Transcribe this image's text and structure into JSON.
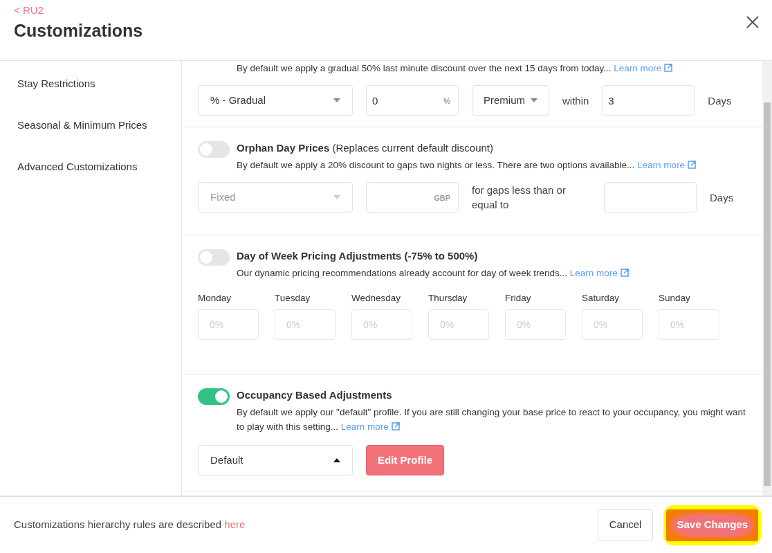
{
  "back_link": "< RU2",
  "title": "Customizations",
  "sidebar": {
    "items": [
      {
        "label": "Stay Restrictions"
      },
      {
        "label": "Seasonal & Minimum Prices"
      },
      {
        "label": "Advanced Customizations"
      }
    ]
  },
  "sections": [
    {
      "description": "By default we apply a gradual 50% last minute discount over the next 15 days from today...",
      "link": "Learn more",
      "controls": [
        {
          "kind": "select",
          "value": "% - Gradual",
          "disabled": false,
          "expanded": false
        },
        {
          "kind": "input",
          "value": "0",
          "suffix": "%"
        },
        {
          "kind": "dropdown",
          "value": "Premium"
        },
        {
          "kind": "label",
          "text": "within"
        },
        {
          "kind": "input",
          "value": "3"
        },
        {
          "kind": "label",
          "text": "Days"
        }
      ]
    },
    {
      "on": false,
      "title": "**Orphan Day Prices** (Replaces current default discount)",
      "description": "By default we apply a 20% discount to gaps two nights or less. There are two options available...",
      "link": "Learn more",
      "controls": [
        {
          "kind": "select",
          "value": "Fixed",
          "disabled": true,
          "expanded": false
        },
        {
          "kind": "input",
          "suffix": "GBP"
        },
        {
          "kind": "label",
          "text": "for gaps less than or equal to"
        },
        {
          "kind": "input"
        },
        {
          "kind": "label",
          "text": "Days"
        }
      ]
    },
    {
      "on": false,
      "title": "**Day of Week Pricing Adjustments (-75% to 500%)**",
      "description": "Our dynamic pricing recommendations already account for day of week trends...",
      "link": "Learn more",
      "controls": [
        {
          "kind": "day",
          "label": "Monday",
          "placeholder": "0%"
        },
        {
          "kind": "day",
          "label": "Tuesday",
          "placeholder": "0%"
        },
        {
          "kind": "day",
          "label": "Wednesday",
          "placeholder": "0%"
        },
        {
          "kind": "day",
          "label": "Thursday",
          "placeholder": "0%"
        },
        {
          "kind": "day",
          "label": "Friday",
          "placeholder": "0%"
        },
        {
          "kind": "day",
          "label": "Saturday",
          "placeholder": "0%"
        },
        {
          "kind": "day",
          "label": "Sunday",
          "placeholder": "0%"
        }
      ]
    },
    {
      "on": true,
      "title": "**Occupancy Based Adjustments**",
      "description": "By default we apply our \"default\" profile. If you are still changing your base price to react to your occupancy, you might want to play with this setting...",
      "link": "Learn more",
      "controls": [
        {
          "kind": "select",
          "value": "Default",
          "disabled": false,
          "expanded": true
        },
        {
          "kind": "button",
          "label": "Edit Profile"
        }
      ]
    }
  ],
  "footer": {
    "note": "Customizations hierarchy rules are described",
    "link": "here",
    "buttons": [
      {
        "label": "Cancel",
        "kind": "secondary"
      },
      {
        "label": "Save Changes",
        "kind": "primary",
        "highlighted": true
      }
    ]
  }
}
